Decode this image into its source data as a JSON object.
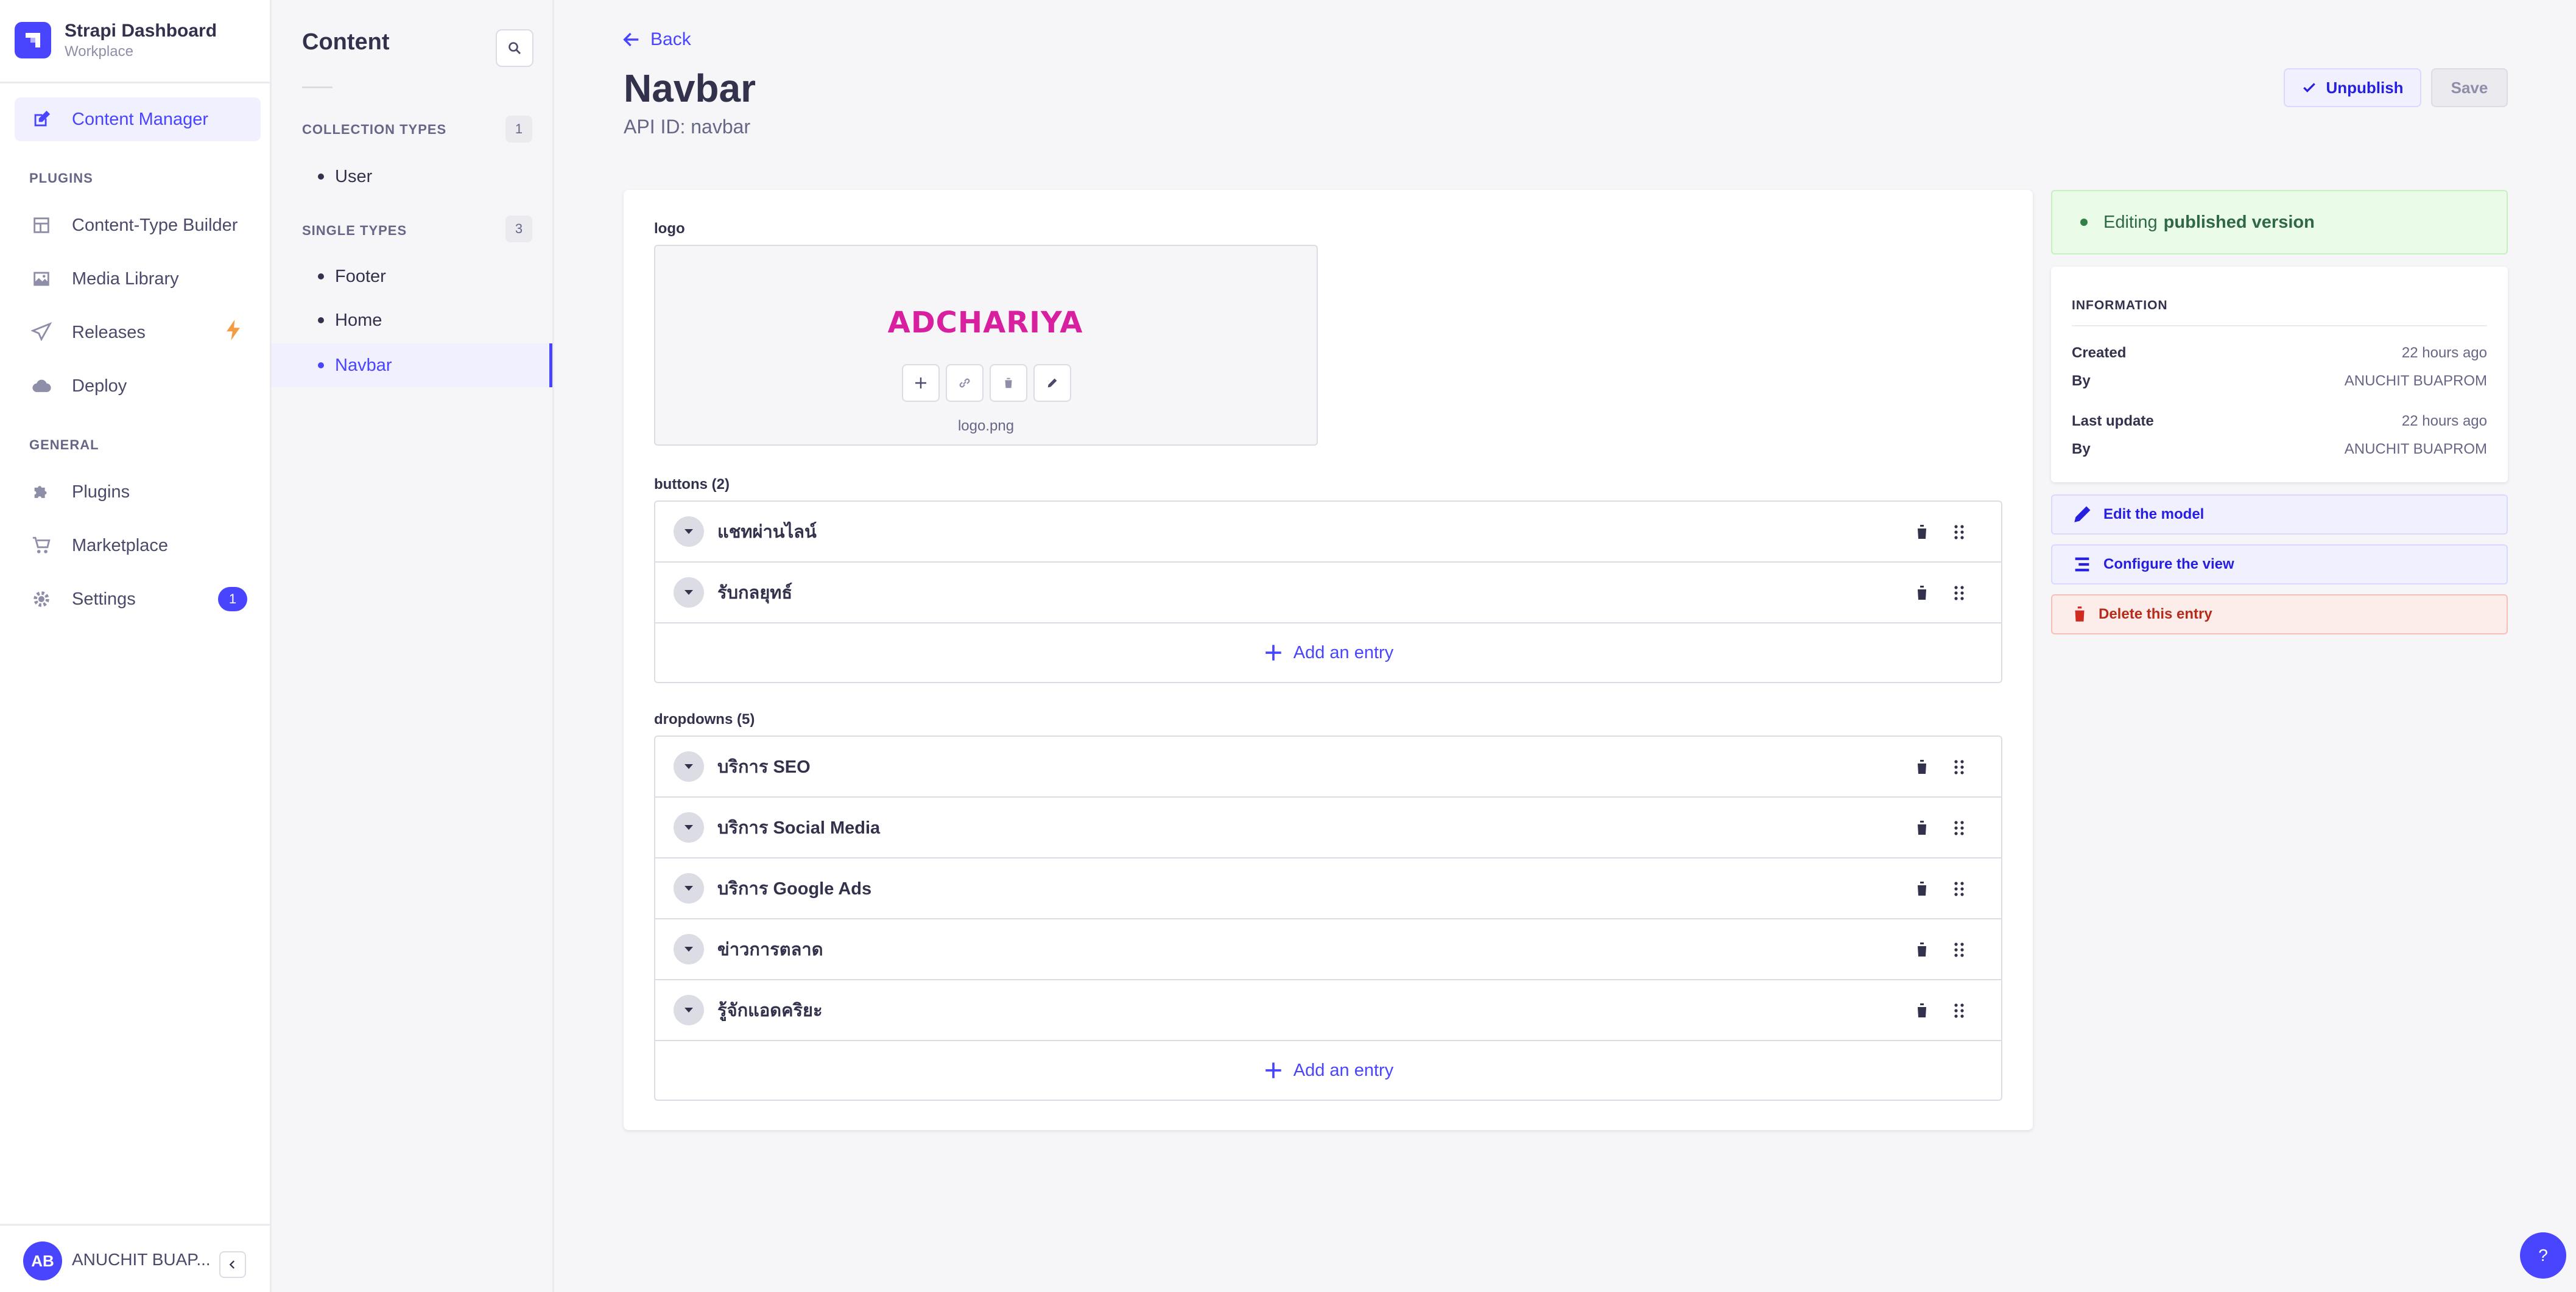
{
  "brand": {
    "title": "Strapi Dashboard",
    "subtitle": "Workplace"
  },
  "mainnav": {
    "content_manager": "Content Manager",
    "plugins_section": "PLUGINS",
    "content_type_builder": "Content-Type Builder",
    "media_library": "Media Library",
    "releases": "Releases",
    "deploy": "Deploy",
    "general_section": "GENERAL",
    "plugins": "Plugins",
    "marketplace": "Marketplace",
    "settings": "Settings",
    "settings_badge": "1"
  },
  "user": {
    "initials": "AB",
    "name": "ANUCHIT BUAP..."
  },
  "subnav": {
    "title": "Content",
    "collection_types": {
      "label": "COLLECTION TYPES",
      "count": "1",
      "items": [
        "User"
      ]
    },
    "single_types": {
      "label": "SINGLE TYPES",
      "count": "3",
      "items": [
        "Footer",
        "Home",
        "Navbar"
      ]
    }
  },
  "header": {
    "back": "Back",
    "title": "Navbar",
    "api_id": "API ID: navbar",
    "unpublish": "Unpublish",
    "save": "Save"
  },
  "editor": {
    "logo_label": "logo",
    "logo_text": "ADCHARIYA",
    "logo_filename": "logo.png",
    "buttons_label": "buttons (2)",
    "buttons": [
      "แชทผ่านไลน์",
      "รับกลยุทธ์"
    ],
    "dropdowns_label": "dropdowns (5)",
    "dropdowns": [
      "บริการ SEO",
      "บริการ Social Media",
      "บริการ Google Ads",
      "ข่าวการตลาด",
      "รู้จักแอดคริยะ"
    ],
    "add_entry": "Add an entry"
  },
  "panel": {
    "status_prefix": "Editing",
    "status_bold": "published version",
    "info_title": "INFORMATION",
    "created_label": "Created",
    "created_value": "22 hours ago",
    "created_by_label": "By",
    "created_by_value": "ANUCHIT BUAPROM",
    "updated_label": "Last update",
    "updated_value": "22 hours ago",
    "updated_by_label": "By",
    "updated_by_value": "ANUCHIT BUAPROM",
    "edit_model": "Edit the model",
    "configure_view": "Configure the view",
    "delete_entry": "Delete this entry"
  },
  "help": "?",
  "colors": {
    "primary": "#4945ff",
    "danger": "#b72b1a",
    "success": "#328048",
    "logo": "#d81fa0"
  }
}
